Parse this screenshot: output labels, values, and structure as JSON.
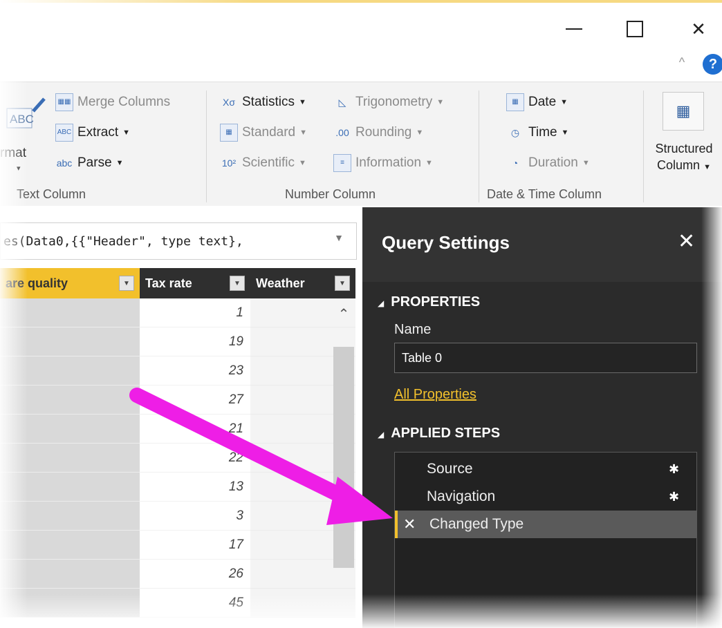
{
  "window": {
    "minimize_icon": "minimize-icon",
    "maximize_icon": "maximize-icon",
    "close_glyph": "✕",
    "collapse_glyph": "^",
    "help_glyph": "?"
  },
  "ribbon": {
    "text_column": {
      "format_label": "rmat",
      "merge_columns": "Merge Columns",
      "extract": "Extract",
      "parse": "Parse",
      "group_label": "Text Column"
    },
    "number_column": {
      "statistics": "Statistics",
      "standard": "Standard",
      "scientific": "Scientific",
      "trigonometry": "Trigonometry",
      "rounding": "Rounding",
      "information": "Information",
      "group_label": "Number Column"
    },
    "datetime_column": {
      "date": "Date",
      "time": "Time",
      "duration": "Duration",
      "group_label": "Date & Time Column"
    },
    "structured": {
      "line1": "Structured",
      "line2": "Column"
    }
  },
  "formula_bar": {
    "text": "es(Data0,{{\"Header\", type text},"
  },
  "grid": {
    "columns": [
      "are quality",
      "Tax rate",
      "Weather"
    ],
    "tax_rate_values": [
      "1",
      "19",
      "23",
      "27",
      "21",
      "22",
      "13",
      "3",
      "17",
      "26",
      "45"
    ]
  },
  "query_settings": {
    "title": "Query Settings",
    "close_glyph": "✕",
    "properties_heading": "PROPERTIES",
    "name_label": "Name",
    "name_value": "Table 0",
    "all_properties_link": "All Properties",
    "applied_steps_heading": "APPLIED STEPS",
    "steps": [
      "Source",
      "Navigation",
      "Changed Type"
    ],
    "selected_step_index": 2
  },
  "colors": {
    "accent_yellow": "#f2c02c",
    "arrow_magenta": "#ee1ee6",
    "panel_dark": "#2b2b2b"
  }
}
